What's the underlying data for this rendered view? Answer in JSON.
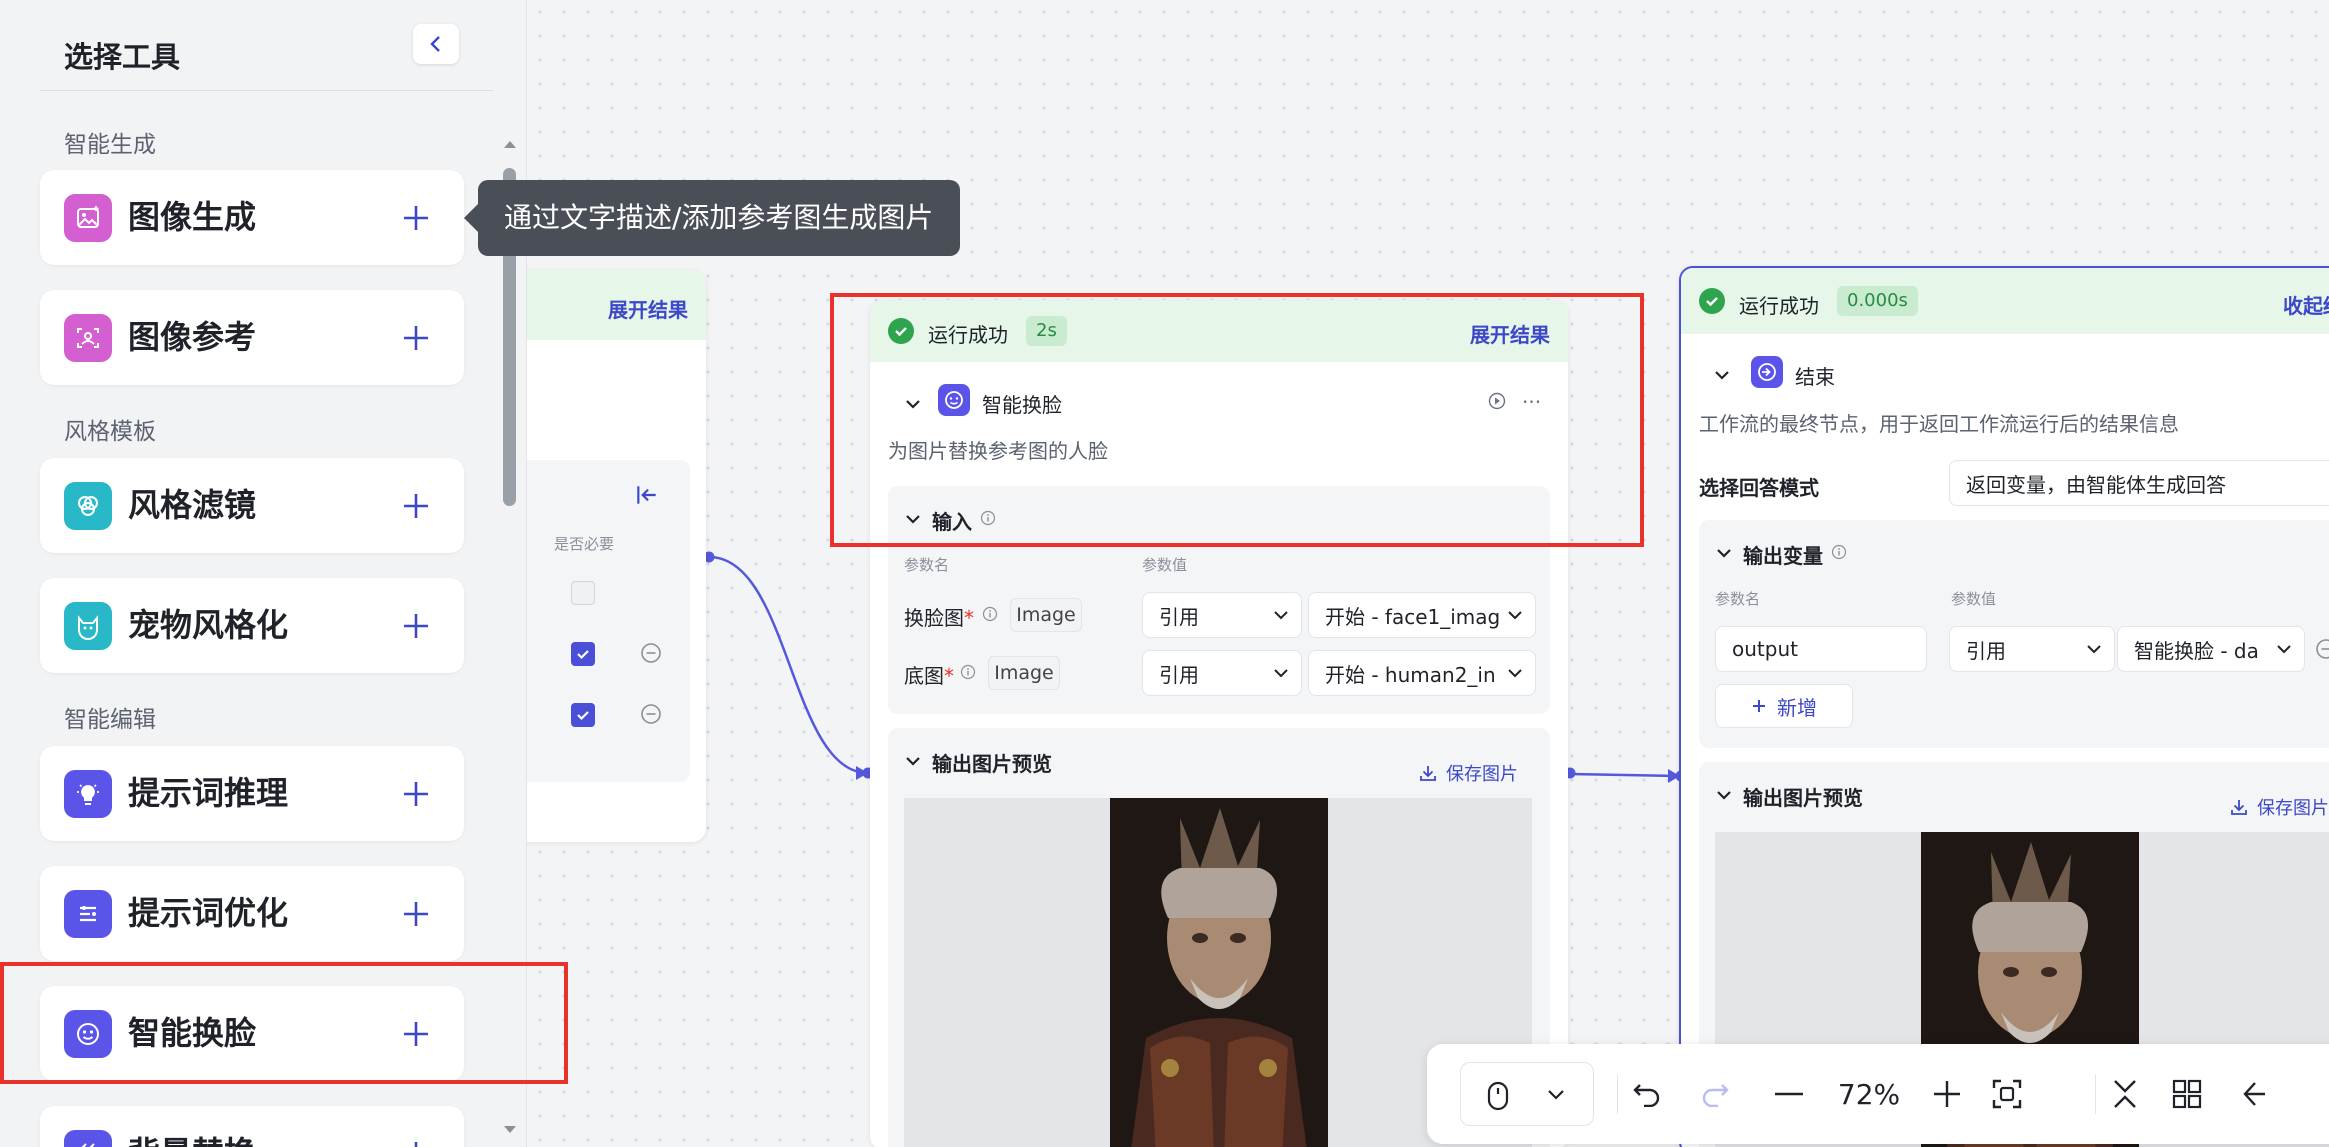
{
  "sidebar": {
    "title": "选择工具",
    "categories": [
      "智能生成",
      "风格模板",
      "智能编辑"
    ],
    "tools": [
      {
        "label": "图像生成",
        "icon": "image-generate-icon",
        "color": "#d45fd1"
      },
      {
        "label": "图像参考",
        "icon": "image-reference-icon",
        "color": "#d45fd1"
      },
      {
        "label": "风格滤镜",
        "icon": "style-filter-icon",
        "color": "#28b8c8"
      },
      {
        "label": "宠物风格化",
        "icon": "pet-icon",
        "color": "#28b8c8"
      },
      {
        "label": "提示词推理",
        "icon": "lightbulb-icon",
        "color": "#5a55e8"
      },
      {
        "label": "提示词优化",
        "icon": "list-optimize-icon",
        "color": "#5a55e8"
      },
      {
        "label": "智能换脸",
        "icon": "face-icon",
        "color": "#5a55e8"
      },
      {
        "label": "背景替换",
        "icon": "background-icon",
        "color": "#5a55e8"
      }
    ]
  },
  "tooltip": "通过文字描述/添加参考图生成图片",
  "left_node": {
    "expand_label": "展开结果",
    "required_header": "是否必要"
  },
  "face_node": {
    "status": "运行成功",
    "duration": "2s",
    "expand_label": "展开结果",
    "title": "智能换脸",
    "description": "为图片替换参考图的人脸",
    "input_title": "输入",
    "col_param_name": "参数名",
    "col_param_value": "参数值",
    "rows": [
      {
        "name": "换脸图",
        "type": "Image",
        "mode": "引用",
        "value": "开始 - face1_imag"
      },
      {
        "name": "底图",
        "type": "Image",
        "mode": "引用",
        "value": "开始 - human2_in"
      }
    ],
    "preview_title": "输出图片预览",
    "save_label": "保存图片"
  },
  "end_node": {
    "status": "运行成功",
    "duration": "0.000s",
    "collapse_label": "收起结",
    "title": "结束",
    "description": "工作流的最终节点，用于返回工作流运行后的结果信息",
    "answer_mode_label": "选择回答模式",
    "answer_mode_value": "返回变量，由智能体生成回答",
    "output_title": "输出变量",
    "col_param_name": "参数名",
    "col_param_value": "参数值",
    "output_name": "output",
    "output_mode": "引用",
    "output_value": "智能换脸 - da",
    "add_label": "新增",
    "preview_title": "输出图片预览",
    "save_label": "保存图片"
  },
  "toolbar": {
    "zoom": "72%"
  }
}
